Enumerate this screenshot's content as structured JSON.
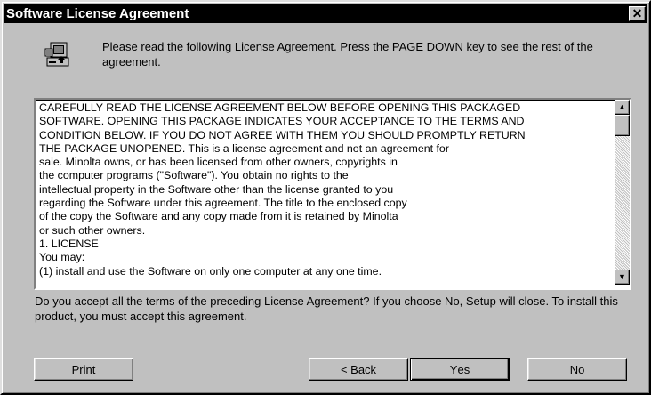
{
  "window": {
    "title": "Software License Agreement",
    "close_glyph": "✕"
  },
  "header": {
    "icon": "setup-computer-icon",
    "text": "Please read the following License Agreement. Press the PAGE DOWN key to see the rest of the agreement."
  },
  "license": {
    "text": "CAREFULLY READ THE LICENSE AGREEMENT BELOW BEFORE OPENING THIS PACKAGED\nSOFTWARE. OPENING THIS PACKAGE INDICATES YOUR ACCEPTANCE TO THE TERMS AND\nCONDITION BELOW. IF YOU DO NOT AGREE WITH THEM YOU SHOULD PROMPTLY RETURN\nTHE PACKAGE UNOPENED. This is a license agreement and not an agreement for\nsale. Minolta owns, or has been licensed from other owners, copyrights in\nthe computer programs (\"Software\"). You obtain no rights to the\nintellectual property in the Software other than the license granted to you\nregarding the Software under this agreement. The title to the enclosed copy\nof the copy the Software and any copy made from it is retained by Minolta\nor such other owners.\n1. LICENSE\nYou may:\n(1) install and use the Software on only one computer at any one time."
  },
  "scrollbar": {
    "up_glyph": "▲",
    "down_glyph": "▼"
  },
  "question": {
    "text": "Do you accept all the terms of the preceding License Agreement? If you choose No, Setup will close. To install this product, you must accept this agreement."
  },
  "buttons": {
    "print": {
      "mnemonic": "P",
      "rest": "rint"
    },
    "back": {
      "prefix": "< ",
      "mnemonic": "B",
      "rest": "ack"
    },
    "yes": {
      "mnemonic": "Y",
      "rest": "es"
    },
    "no": {
      "mnemonic": "N",
      "rest": "o"
    }
  },
  "colors": {
    "title_bar": "#000000",
    "dialog_face": "#c0c0c0",
    "text_area": "#ffffff"
  }
}
